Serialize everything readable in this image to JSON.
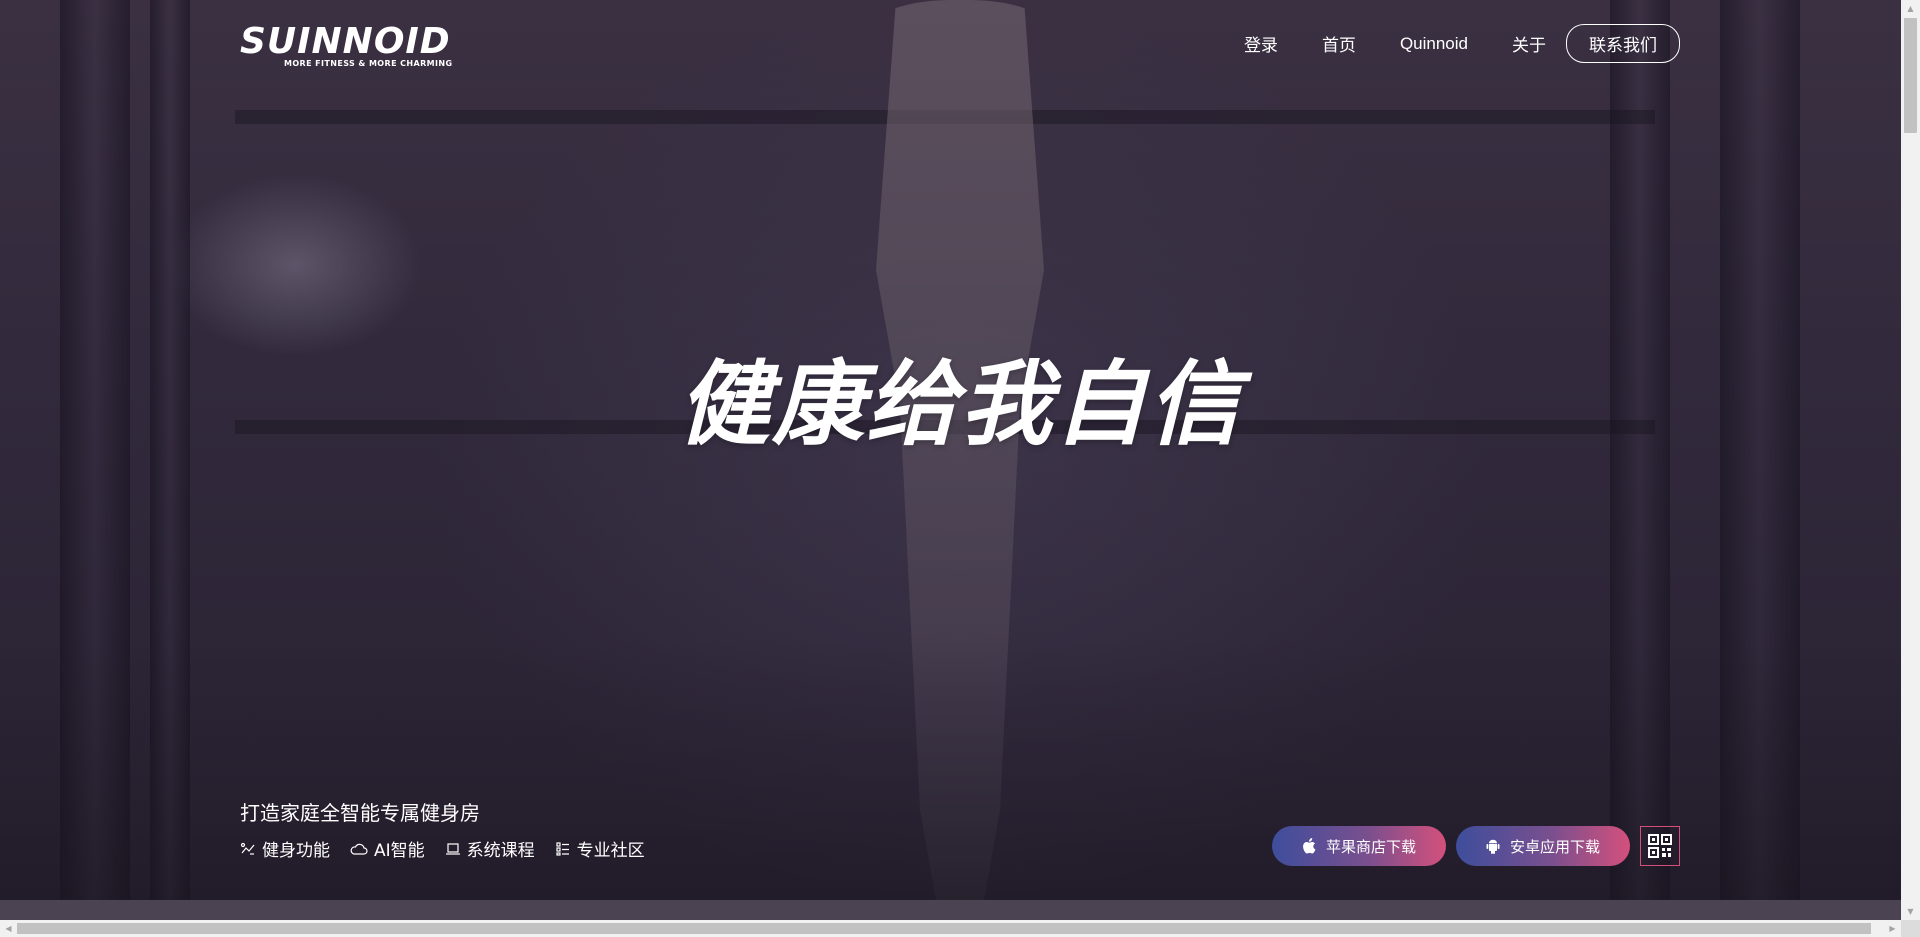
{
  "logo": {
    "wordmark": "SUINNOID",
    "tagline": "MORE FITNESS & MORE CHARMING"
  },
  "nav": {
    "items": [
      {
        "label": "登录"
      },
      {
        "label": "首页"
      },
      {
        "label": "Quinnoid"
      },
      {
        "label": "关于"
      }
    ],
    "contact_label": "联系我们"
  },
  "hero": {
    "headline": "健康给我自信",
    "tagline": "打造家庭全智能专属健身房",
    "features": [
      {
        "icon": "fitness-icon",
        "label": "健身功能"
      },
      {
        "icon": "cloud-icon",
        "label": "AI智能"
      },
      {
        "icon": "laptop-icon",
        "label": "系统课程"
      },
      {
        "icon": "list-icon",
        "label": "专业社区"
      }
    ]
  },
  "downloads": {
    "ios_label": "苹果商店下载",
    "android_label": "安卓应用下载",
    "qr_icon": "qr-code-icon"
  },
  "colors": {
    "accent_start": "#3e4e9c",
    "accent_end": "#d4507c",
    "background": "#2a2233"
  }
}
